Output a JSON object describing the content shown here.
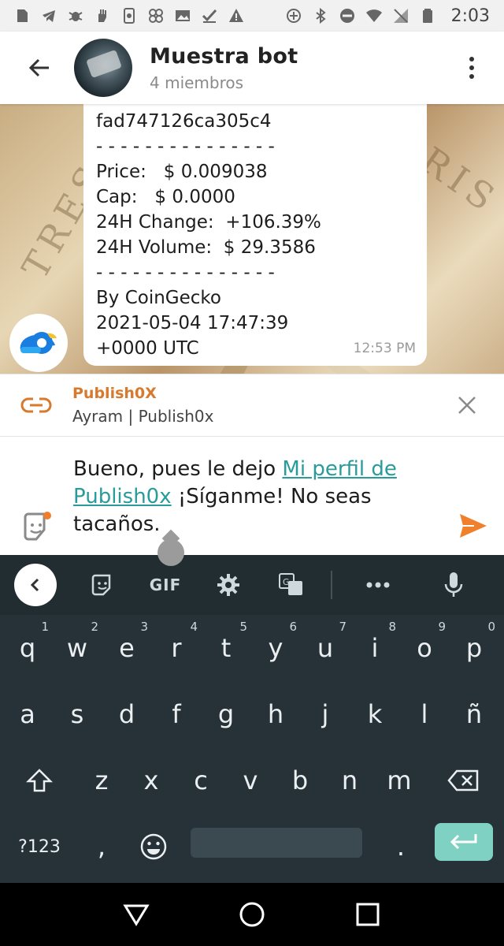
{
  "status_bar": {
    "time": "2:03",
    "icons": [
      "sd-card-icon",
      "telegram-icon",
      "bug-icon",
      "hand-icon",
      "phone-icon",
      "pinwheel-icon",
      "image-icon",
      "check-icon",
      "warning-icon",
      "add-circle-icon",
      "bluetooth-icon",
      "dnd-icon",
      "wifi-icon",
      "no-signal-icon",
      "battery-icon"
    ]
  },
  "header": {
    "title": "Muestra bot",
    "subtitle": "4 miembros"
  },
  "message": {
    "lines": [
      "fad747126ca305c4",
      "- - - - - - - - - - - - - - -",
      "Price:   $ 0.009038",
      "Cap:   $ 0.0000",
      "24H Change:  +106.39%",
      "24H Volume:  $ 29.3586",
      "- - - - - - - - - - - - - - -",
      "By CoinGecko",
      "2021-05-04 17:47:39",
      "+0000 UTC"
    ],
    "time": "12:53 PM"
  },
  "link_preview": {
    "title": "Publish0X",
    "subtitle": "Ayram | Publish0x"
  },
  "composer": {
    "text_before": "Bueno, pues le dejo ",
    "link_text": "Mi perfil de Publish0x",
    "text_after": " ¡Síganme! No seas tacaños."
  },
  "keyboard": {
    "toolbar": {
      "gif_label": "GIF"
    },
    "row1": [
      {
        "key": "q",
        "num": "1"
      },
      {
        "key": "w",
        "num": "2"
      },
      {
        "key": "e",
        "num": "3"
      },
      {
        "key": "r",
        "num": "4"
      },
      {
        "key": "t",
        "num": "5"
      },
      {
        "key": "y",
        "num": "6"
      },
      {
        "key": "u",
        "num": "7"
      },
      {
        "key": "i",
        "num": "8"
      },
      {
        "key": "o",
        "num": "9"
      },
      {
        "key": "p",
        "num": "0"
      }
    ],
    "row2": [
      "a",
      "s",
      "d",
      "f",
      "g",
      "h",
      "j",
      "k",
      "l",
      "ñ"
    ],
    "row3": [
      "z",
      "x",
      "c",
      "v",
      "b",
      "n",
      "m"
    ],
    "row4": {
      "symbols_label": "?123",
      "comma": ",",
      "period": "."
    }
  }
}
